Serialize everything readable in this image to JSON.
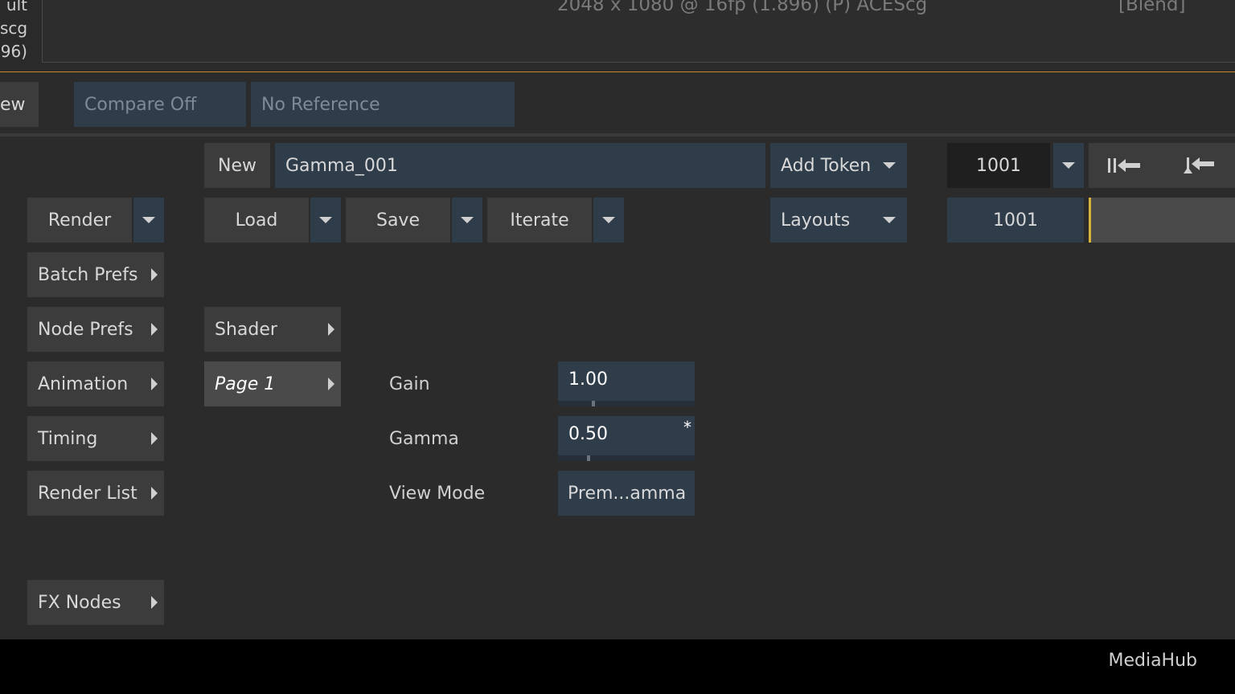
{
  "viewer": {
    "left_lines": [
      "ult",
      "scg",
      "96)"
    ],
    "info": "2048 x 1080 @ 16fp (1.896) (P) ACEScg",
    "blend": "[Blend]"
  },
  "compare_bar": {
    "view_label": "ew",
    "compare": "Compare Off",
    "reference": "No Reference"
  },
  "setup": {
    "new_label": "New",
    "name_value": "Gamma_001",
    "add_token": "Add Token",
    "frame_value": "1001",
    "frame_value_2": "1001",
    "load": "Load",
    "save": "Save",
    "iterate": "Iterate",
    "layouts": "Layouts"
  },
  "sidebar": {
    "render": "Render",
    "batch_prefs": "Batch Prefs",
    "node_prefs": "Node Prefs",
    "animation": "Animation",
    "timing": "Timing",
    "render_list": "Render List",
    "fx_nodes": "FX Nodes"
  },
  "pages": {
    "shader": "Shader",
    "page1": "Page 1"
  },
  "params": {
    "gain_label": "Gain",
    "gain_value": "1.00",
    "gamma_label": "Gamma",
    "gamma_value": "0.50",
    "gamma_modified": "*",
    "viewmode_label": "View Mode",
    "viewmode_value": "Prem...amma"
  },
  "footer": {
    "app": "MediaHub"
  },
  "colors": {
    "accent_orange": "#c98a2c",
    "accent_yellow": "#d6b33a",
    "field_blue": "#2f3c4a"
  }
}
